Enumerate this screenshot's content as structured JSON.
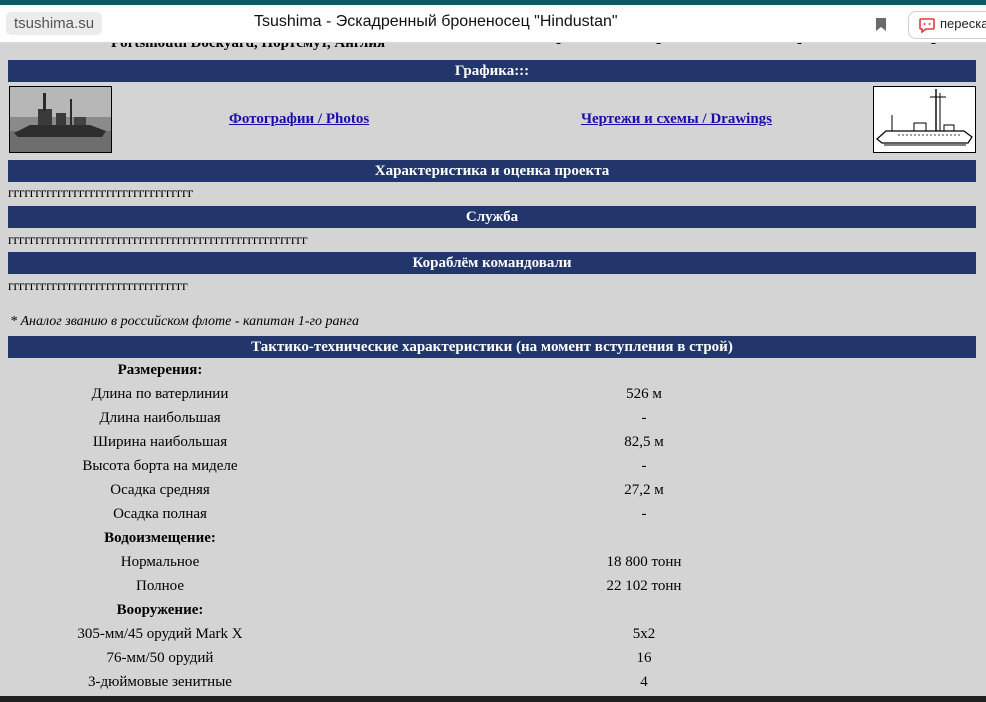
{
  "browser": {
    "host": "tsushima.su",
    "title": "Tsushima - Эскадренный броненосец \"Hindustan\"",
    "translate_label": "пересказ"
  },
  "top_row": {
    "place": "Portsmouth Dockyard, Портсмут, Англия",
    "dashes": [
      "-",
      "-",
      "-",
      "-"
    ]
  },
  "graphics": {
    "heading": "Графика:::",
    "photos_link": "Фотографии / Photos",
    "drawings_link": "Чертежи и схемы / Drawings"
  },
  "sections": {
    "project_heading": "Характеристика и оценка проекта",
    "project_text": "гггггггггггггггггггггггггггггггггг",
    "service_heading": "Служба",
    "service_text": "ггггггггггггггггггггггггггггггггггггггггггггггггггггггг",
    "commanders_heading": "Кораблём командовали",
    "commanders_text": "ггггггггггггггггггггггггггггггггг",
    "footnote": "* Аналог званию в российском флоте - капитан 1-го ранга"
  },
  "specs": {
    "heading": "Тактико-технические характеристики (на момент вступления в строй)",
    "rows": [
      {
        "kind": "head",
        "label": "Размерения:",
        "value": ""
      },
      {
        "kind": "row",
        "label": "Длина по ватерлинии",
        "value": "526 м"
      },
      {
        "kind": "row",
        "label": "Длина наибольшая",
        "value": "-"
      },
      {
        "kind": "row",
        "label": "Ширина наибольшая",
        "value": "82,5 м"
      },
      {
        "kind": "row",
        "label": "Высота борта на миделе",
        "value": "-"
      },
      {
        "kind": "row",
        "label": "Осадка средняя",
        "value": "27,2 м"
      },
      {
        "kind": "row",
        "label": "Осадка полная",
        "value": "-"
      },
      {
        "kind": "head",
        "label": "Водоизмещение:",
        "value": ""
      },
      {
        "kind": "row",
        "label": "Нормальное",
        "value": "18 800 тонн"
      },
      {
        "kind": "row",
        "label": "Полное",
        "value": "22 102 тонн"
      },
      {
        "kind": "head",
        "label": "Вооружение:",
        "value": ""
      },
      {
        "kind": "row",
        "label": "305-мм/45 орудий Mark X",
        "value": "5x2"
      },
      {
        "kind": "row",
        "label": "76-мм/50 орудий",
        "value": "16"
      },
      {
        "kind": "row",
        "label": "3-дюймовые зенитные",
        "value": "4"
      }
    ]
  }
}
